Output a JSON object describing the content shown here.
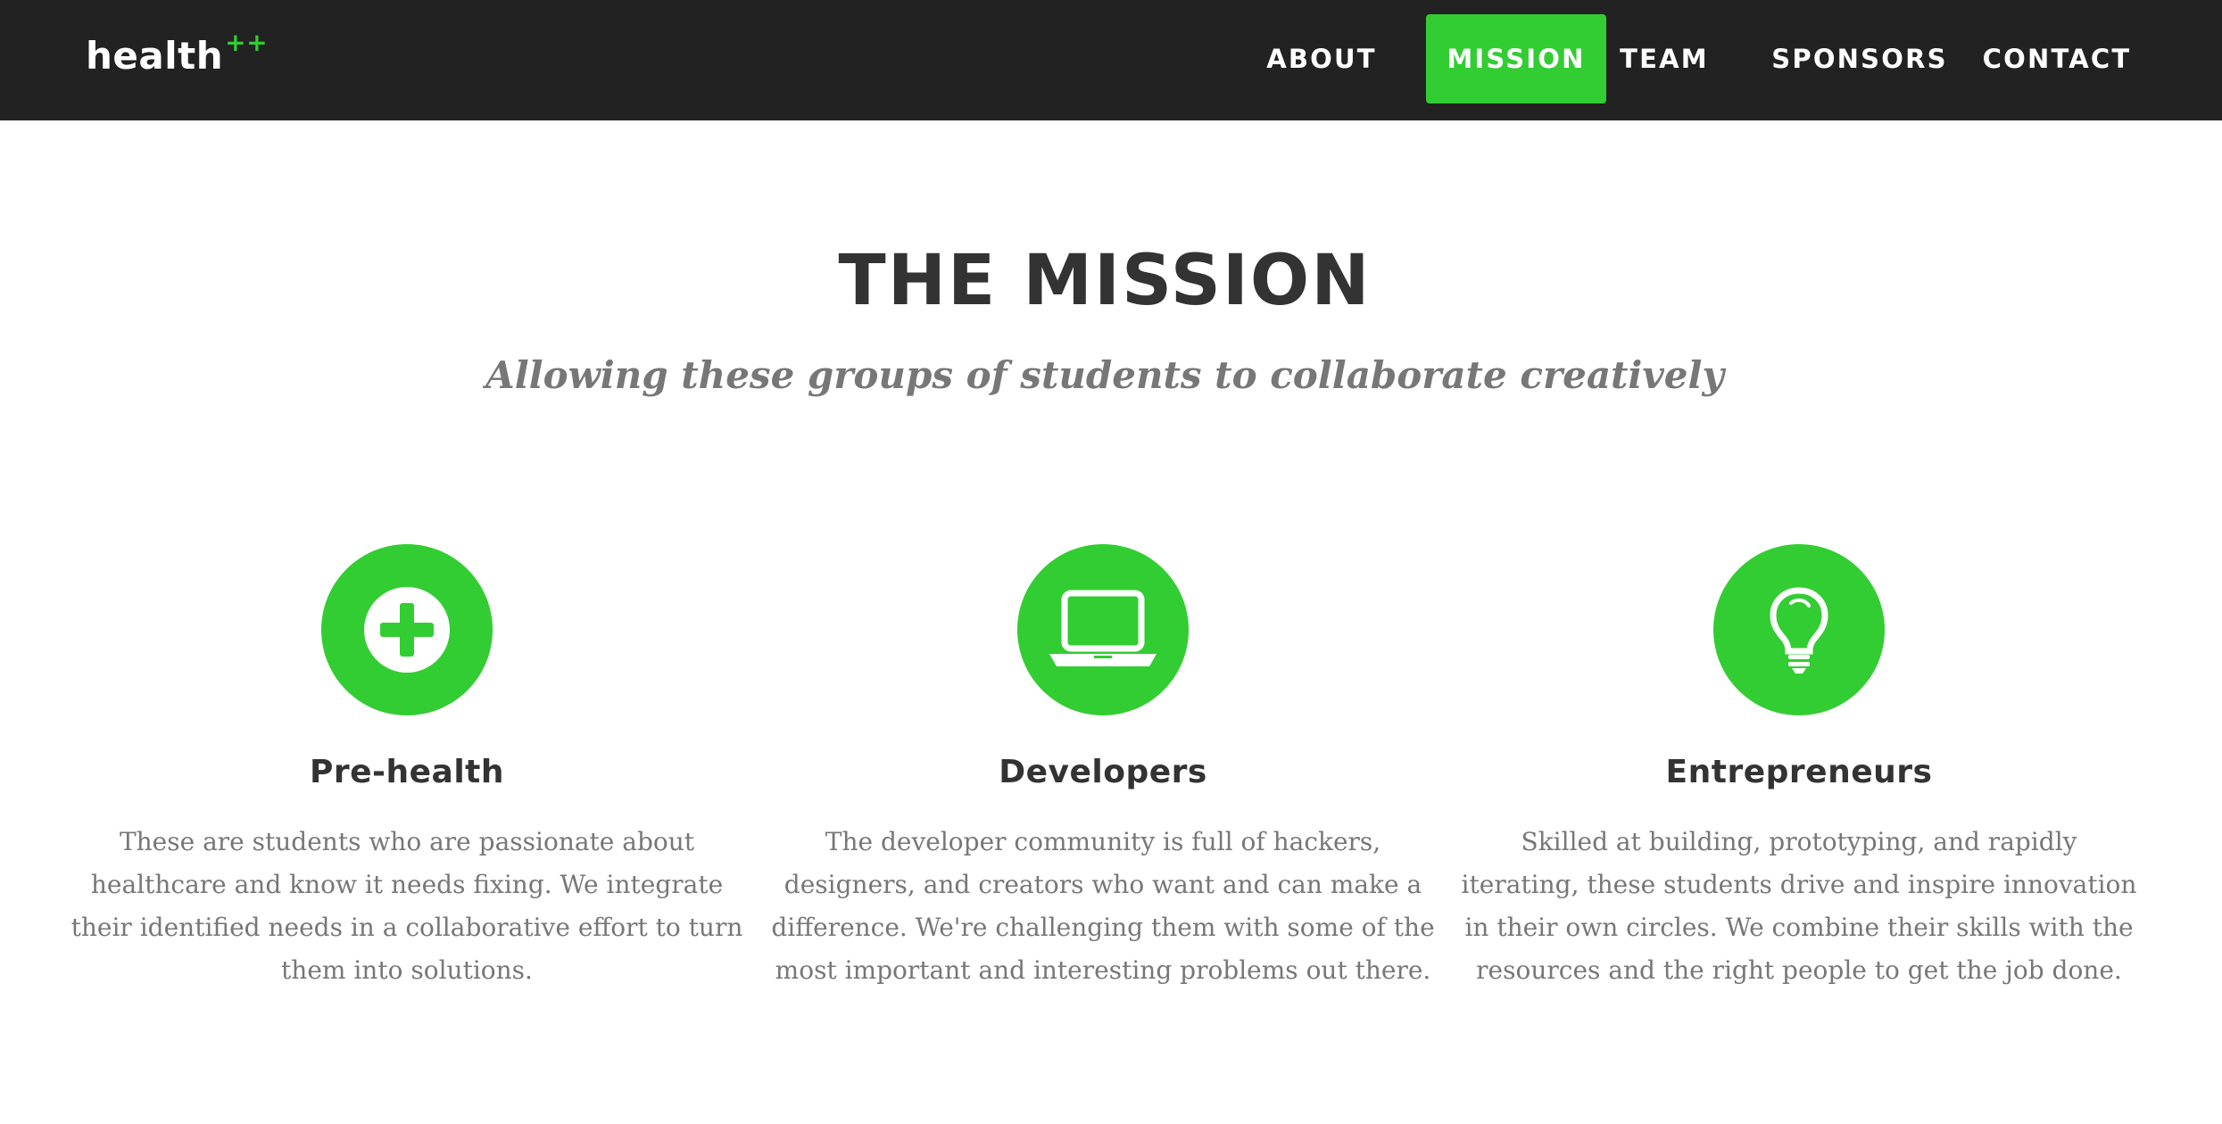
{
  "brand": {
    "name": "health",
    "suffix": "++"
  },
  "nav": {
    "items": [
      {
        "label": "ABOUT",
        "active": false
      },
      {
        "label": "MISSION",
        "active": true
      },
      {
        "label": "TEAM",
        "active": false
      },
      {
        "label": "SPONSORS",
        "active": false
      },
      {
        "label": "CONTACT",
        "active": false
      }
    ]
  },
  "section": {
    "title": "THE MISSION",
    "subtitle": "Allowing these groups of students to collaborate creatively"
  },
  "features": [
    {
      "icon": "plus-circle-icon",
      "title": "Pre-health",
      "text": "These are students who are passionate about healthcare and know it needs fixing. We integrate their identified needs in a collaborative effort to turn them into solutions."
    },
    {
      "icon": "laptop-icon",
      "title": "Developers",
      "text": "The developer community is full of hackers, designers, and creators who want and can make a difference. We're challenging them with some of the most important and interesting problems out there."
    },
    {
      "icon": "lightbulb-icon",
      "title": "Entrepreneurs",
      "text": "Skilled at building, prototyping, and rapidly iterating, these students drive and inspire innovation in their own circles. We combine their skills with the resources and the right people to get the job done."
    }
  ],
  "colors": {
    "navbar_bg": "#222222",
    "accent": "#32cd32",
    "heading": "#333333",
    "muted_text": "#777777",
    "page_bg": "#ffffff"
  }
}
